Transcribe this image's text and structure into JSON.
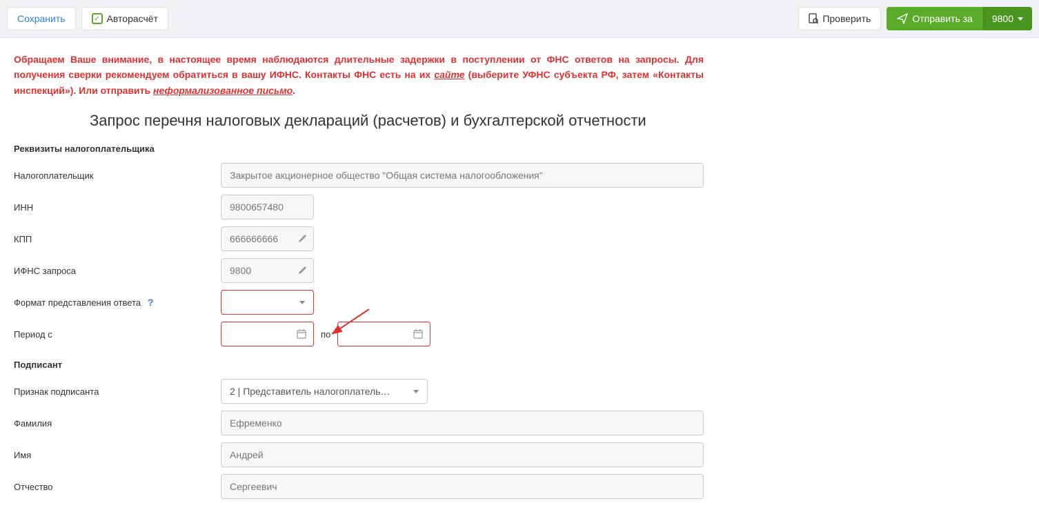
{
  "toolbar": {
    "save": "Сохранить",
    "autocalc": "Авторасчёт",
    "check": "Проверить",
    "send": "Отправить за",
    "code": "9800"
  },
  "alert": {
    "part1": "Обращаем Ваше внимание, в настоящее время наблюдаются длительные задержки в поступлении от ФНС ответов на запросы. Для получения сверки рекомендуем обратиться в вашу ИФНС. Контакты ФНС есть на их ",
    "link1": "сайте",
    "part2": " (выберите УФНС субъекта РФ, затем «Контакты инспекций»). Или отправить ",
    "link2": "неформализованное письмо",
    "part3": "."
  },
  "page_title": "Запрос перечня налоговых деклараций (расчетов) и бухгалтерской отчетности",
  "sections": {
    "taxpayer": "Реквизиты налогоплательщика",
    "signer": "Подписант"
  },
  "labels": {
    "taxpayer": "Налогоплательщик",
    "inn": "ИНН",
    "kpp": "КПП",
    "ifns": "ИФНС запроса",
    "format": "Формат представления ответа",
    "period_from": "Период c",
    "period_to": "по",
    "signer_type": "Признак подписанта",
    "last_name": "Фамилия",
    "first_name": "Имя",
    "middle_name": "Отчество"
  },
  "values": {
    "taxpayer": "Закрытое акционерное общество \"Общая система налогообложения\"",
    "inn": "9800657480",
    "kpp": "666666666",
    "ifns": "9800",
    "format": "",
    "period_from": "",
    "period_to": "",
    "signer_type": "2 | Представитель налогоплатель…",
    "last_name": "Ефременко",
    "first_name": "Андрей",
    "middle_name": "Сергеевич"
  }
}
